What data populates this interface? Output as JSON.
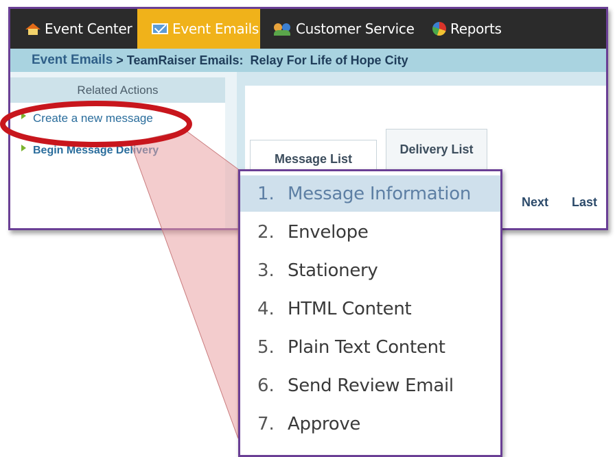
{
  "nav": {
    "items": [
      {
        "label": "Event Center",
        "icon": "home-icon"
      },
      {
        "label": "Event Emails",
        "icon": "mail-icon",
        "active": true
      },
      {
        "label": "Customer Service",
        "icon": "people-icon"
      },
      {
        "label": "Reports",
        "icon": "pie-chart-icon"
      }
    ],
    "active_color": "#f0b21a",
    "background": "#2b2b2b"
  },
  "breadcrumb": {
    "root": "Event Emails",
    "separator": " > ",
    "current": "TeamRaiser Emails:  Relay For Life of Hope City"
  },
  "related_actions": {
    "heading": "Related Actions",
    "links": [
      "Create a new message",
      "Begin Message Delivery"
    ]
  },
  "tabs": [
    "Message List",
    "Delivery List"
  ],
  "pager": {
    "next": "Next",
    "last": "Last"
  },
  "steps": {
    "items": [
      {
        "num": "1.",
        "label": "Message Information",
        "active": true
      },
      {
        "num": "2.",
        "label": "Envelope"
      },
      {
        "num": "3.",
        "label": "Stationery"
      },
      {
        "num": "4.",
        "label": "HTML Content"
      },
      {
        "num": "5.",
        "label": "Plain Text Content"
      },
      {
        "num": "6.",
        "label": "Send Review Email"
      },
      {
        "num": "7.",
        "label": "Approve"
      }
    ]
  },
  "colors": {
    "frame_border": "#6a3f95",
    "highlight_ring": "#c8161d",
    "callout_fill": "#e9a3a4"
  }
}
